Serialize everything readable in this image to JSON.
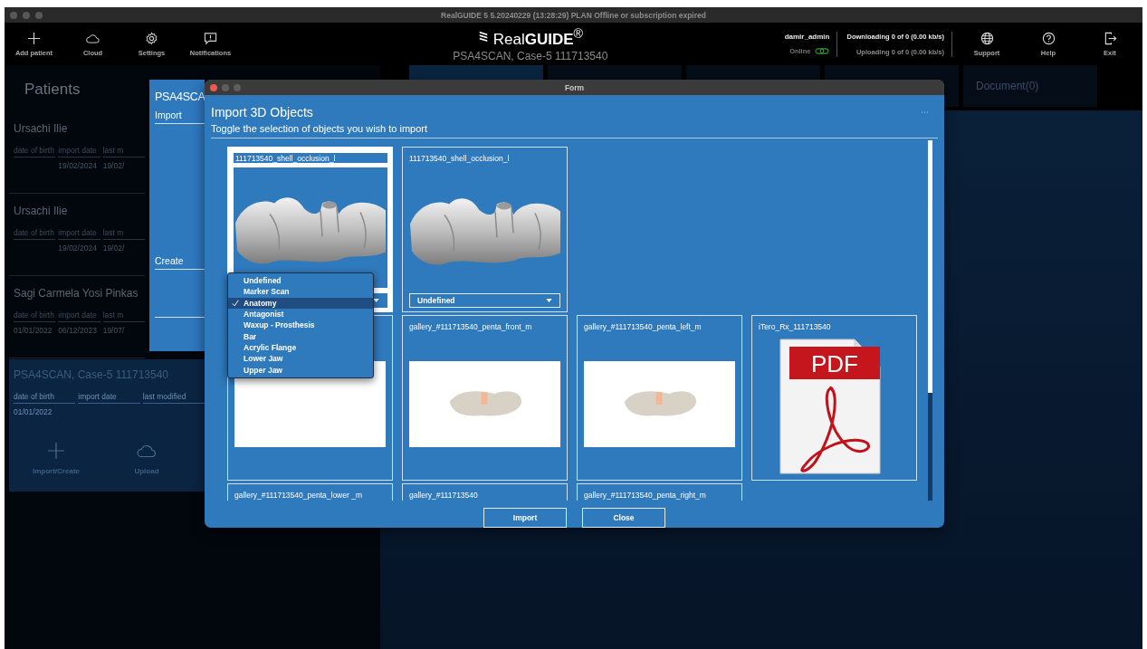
{
  "window": {
    "title": "RealGUIDE 5  5.20240229 (13:28:29)  PLAN Offline or subscription expired"
  },
  "toolbar_left": [
    {
      "label": "Add patient",
      "kind": "plus"
    },
    {
      "label": "Cloud",
      "kind": "cloud"
    },
    {
      "label": "Settings",
      "kind": "gear"
    },
    {
      "label": "Notifications",
      "kind": "message"
    }
  ],
  "logo": {
    "text": "Real**GUIDE**$^{®}$",
    "subtitle": "PSA4SCAN, Case-5 111713540"
  },
  "user": {
    "name": "damir_admin",
    "status": "Online",
    "online": true
  },
  "transfers": {
    "download": "Downloading 0 of 0 (0.00 kb/s)",
    "upload": "Uploading 0 of 0 (0.00 kb/s)"
  },
  "toolbar_right": [
    {
      "label": "Support",
      "kind": "globe"
    },
    {
      "label": "Help",
      "kind": "question"
    },
    {
      "label": "Exit",
      "kind": "exit"
    }
  ],
  "patients": {
    "title": "Patients",
    "items": [
      {
        "name": "Ursachi  Ilie",
        "selected": false,
        "fields": [
          {
            "label": "date of birth"
          },
          {
            "label": "import date",
            "value": "19/02/2024"
          },
          {
            "label": "last m",
            "value": "19/02/"
          }
        ]
      },
      {
        "name": "Ursachi  Ilie",
        "selected": false,
        "fields": [
          {
            "label": "date of birth"
          },
          {
            "label": "import date",
            "value": "19/02/2024"
          },
          {
            "label": "last m",
            "value": "19/02/"
          }
        ]
      },
      {
        "name": "Sagi Carmela Yosi Pinkas",
        "selected": false,
        "fields": [
          {
            "label": "date of birth",
            "value": "01/01/2022"
          },
          {
            "label": "import date",
            "value": "06/12/2023"
          },
          {
            "label": "last m",
            "value": "19/07/"
          }
        ]
      },
      {
        "name": "PSA4SCAN, Case-5  111713540",
        "selected": true,
        "fields": [
          {
            "label": "date of birth",
            "value": "01/01/2022"
          },
          {
            "label": "import date"
          },
          {
            "label": "last modified"
          }
        ],
        "actions": [
          {
            "label": "Import/Create",
            "kind": "plus"
          },
          {
            "label": "Upload",
            "kind": "cloud"
          }
        ]
      }
    ]
  },
  "tabs": [
    {
      "selected": true
    },
    {
      "selected": false
    },
    {
      "selected": false
    },
    {
      "selected": false
    },
    {
      "label": "Document(0)",
      "selected": false
    }
  ],
  "side_window": {
    "title": "PSA4SCA",
    "items": [
      "Import",
      "Create"
    ]
  },
  "form": {
    "title": "Form",
    "heading": "Import 3D Objects",
    "instruction": "Toggle the selection of objects you wish to import",
    "rows": [
      [
        {
          "name": "111713540_shell_occlusion_l",
          "kind": "model",
          "selected": true,
          "menu": [
            {
              "label": "Undefined",
              "selected": false
            },
            {
              "label": "Marker Scan",
              "selected": false
            },
            {
              "label": "Anatomy",
              "selected": true
            },
            {
              "label": "Antagonist",
              "selected": false
            },
            {
              "label": "Waxup - Prosthesis",
              "selected": false
            },
            {
              "label": "Bar",
              "selected": false
            },
            {
              "label": "Acrylic Flange",
              "selected": false
            },
            {
              "label": "Lower Jaw",
              "selected": false
            },
            {
              "label": "Upper Jaw",
              "selected": false
            }
          ]
        },
        {
          "name": "111713540_shell_occlusion_l",
          "kind": "model",
          "selected": false,
          "type": "Undefined"
        }
      ],
      [
        {
          "kind": "blank",
          "selected": false
        },
        {
          "name": "gallery_#111713540_penta_front_m",
          "kind": "photo",
          "selected": false
        },
        {
          "name": "gallery_#111713540_penta_left_m",
          "kind": "photo",
          "selected": false
        },
        {
          "name": "iTero_Rx_111713540",
          "kind": "pdf",
          "badge": "PDF",
          "selected": false
        }
      ],
      [
        {
          "name": "gallery_#111713540_penta_lower _m",
          "kind": "photo",
          "selected": false
        },
        {
          "name": "gallery_#111713540",
          "kind": "photo",
          "selected": false
        },
        {
          "name": "gallery_#111713540_penta_right_m",
          "kind": "photo",
          "selected": false
        }
      ]
    ],
    "buttons": [
      "Import",
      "Close"
    ]
  }
}
